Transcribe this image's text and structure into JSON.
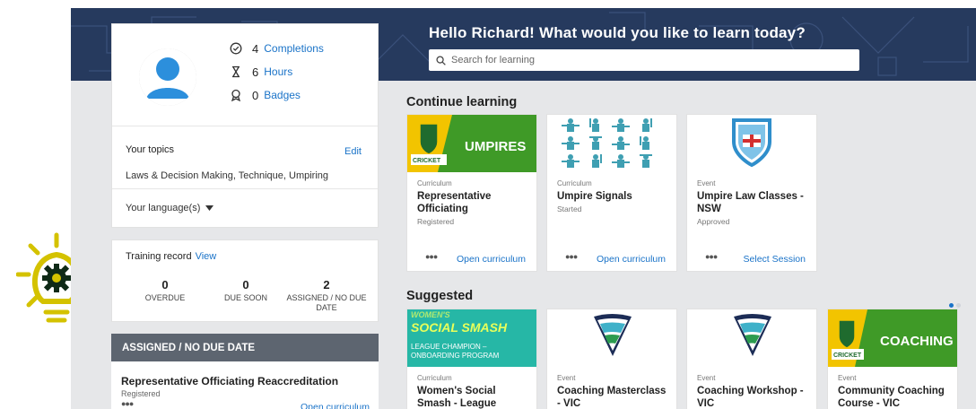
{
  "header": {
    "greeting": "Hello Richard! What would you like to learn today?",
    "search_placeholder": "Search for learning"
  },
  "profile": {
    "stats": [
      {
        "icon": "check-circle-icon",
        "value": "4",
        "label": "Completions"
      },
      {
        "icon": "hourglass-icon",
        "value": "6",
        "label": "Hours"
      },
      {
        "icon": "badge-icon",
        "value": "0",
        "label": "Badges"
      }
    ]
  },
  "topics": {
    "title": "Your topics",
    "edit_label": "Edit",
    "list": "Laws & Decision Making, Technique, Umpiring",
    "language_label": "Your language(s)"
  },
  "training": {
    "title": "Training record",
    "view_label": "View",
    "cols": [
      {
        "value": "0",
        "label": "OVERDUE"
      },
      {
        "value": "0",
        "label": "DUE SOON"
      },
      {
        "value": "2",
        "label": "ASSIGNED / NO DUE DATE"
      }
    ]
  },
  "assigned": {
    "heading": "ASSIGNED / NO DUE DATE",
    "item": {
      "name": "Representative Officiating Reaccreditation",
      "status": "Registered",
      "action": "Open curriculum"
    }
  },
  "continue": {
    "title": "Continue learning",
    "cards": [
      {
        "kind": "Curriculum",
        "title": "Representative Officiating",
        "status": "Registered",
        "action": "Open curriculum",
        "banner": "UMPIRES",
        "logo_text": "CRICKET"
      },
      {
        "kind": "Curriculum",
        "title": "Umpire Signals",
        "status": "Started",
        "action": "Open curriculum"
      },
      {
        "kind": "Event",
        "title": "Umpire Law Classes - NSW",
        "status": "Approved",
        "action": "Select Session"
      }
    ]
  },
  "suggested": {
    "title": "Suggested",
    "cards": [
      {
        "kind": "Curriculum",
        "title": "Women's Social Smash - League",
        "banner_top": "WOMEN'S",
        "banner_main": "SOCIAL SMASH",
        "banner_sub1": "LEAGUE CHAMPION –",
        "banner_sub2": "ONBOARDING PROGRAM"
      },
      {
        "kind": "Event",
        "title": "Coaching Masterclass - VIC"
      },
      {
        "kind": "Event",
        "title": "Coaching Workshop - VIC"
      },
      {
        "kind": "Event",
        "title": "Community Coaching Course - VIC",
        "banner": "COACHING",
        "logo_text": "CRICKET"
      }
    ]
  },
  "colors": {
    "accent": "#1a73c8",
    "banner": "#263a5e",
    "bulb": "#d4c200",
    "cricket_green": "#4a9a2a",
    "cricket_yellow": "#f2c400",
    "smash_teal": "#26b7a6"
  }
}
